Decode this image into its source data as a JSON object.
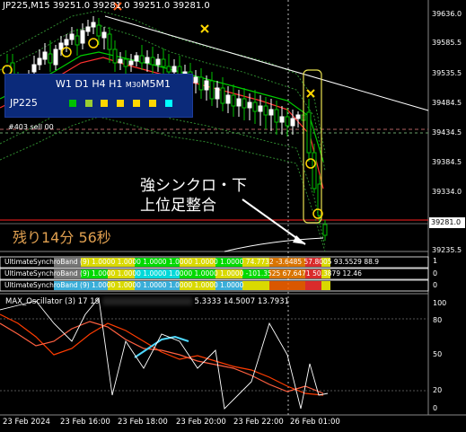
{
  "title": "JP225,M15  39251.0 39281.0 39251.0 39281.0",
  "panel": {
    "timeframes": [
      "W1",
      "D1",
      "H4",
      "H1",
      "M30",
      "M5",
      "M1"
    ],
    "symbol": "JP225",
    "squares": [
      "#00c000",
      "#9acd32",
      "#ffd700",
      "#ffd700",
      "#ffd700",
      "#ffd700",
      "#00ffff"
    ]
  },
  "small_label": "#403      sell  00",
  "annotation": {
    "line1": "強シンクロ・下",
    "line2": "上位足整合"
  },
  "remaining": "残り14分 56秒",
  "ultimate_rows": [
    {
      "label": "UltimateSynchroBand (9)  1.0000  1.0000  1.0000  1.0000  1.0000  1.0000  74.7732  -3.6485 57.8005 93.5529 88.9"
    },
    {
      "label": "UltimateSynchroBand (9)  1.0000  1.0000  1.0000  1.0000  1.0000  1.0000  -101.3525 67.6471 50.3879 12.46"
    },
    {
      "label": "UltimateSynchroBand (9)  1.0000  1.0000  1.0000  1.0000  1.0000  1.0000"
    }
  ],
  "ultimate_scale": [
    "1",
    "0",
    "1",
    "0",
    "1",
    "0"
  ],
  "oscillator": {
    "title": "MAX_Oscillator (3)  17  19",
    "values": "5.3333  14.5007  13.7931",
    "scale": [
      "100",
      "80",
      "50",
      "20",
      "0"
    ]
  },
  "price_scale": [
    "39636.0",
    "39585.5",
    "39535.5",
    "39484.5",
    "39434.5",
    "39384.5",
    "39334.0",
    "39235.5"
  ],
  "current_price": "39281.0",
  "time_axis": [
    "23 Feb 2024",
    "23 Feb 16:00",
    "23 Feb 18:00",
    "23 Feb 20:00",
    "23 Feb 22:00",
    "26 Feb 01:00"
  ],
  "colors": {
    "bull": "#ffffff",
    "bear": "#00c000",
    "upper_band": "#3a8a3a",
    "ma_green": "#00cc00",
    "ma_red": "#ff3030",
    "osc_red": "#ff3c00",
    "osc_cyan": "#4fd8ff",
    "marker": "#ffd700",
    "sell": "#ff2020"
  }
}
